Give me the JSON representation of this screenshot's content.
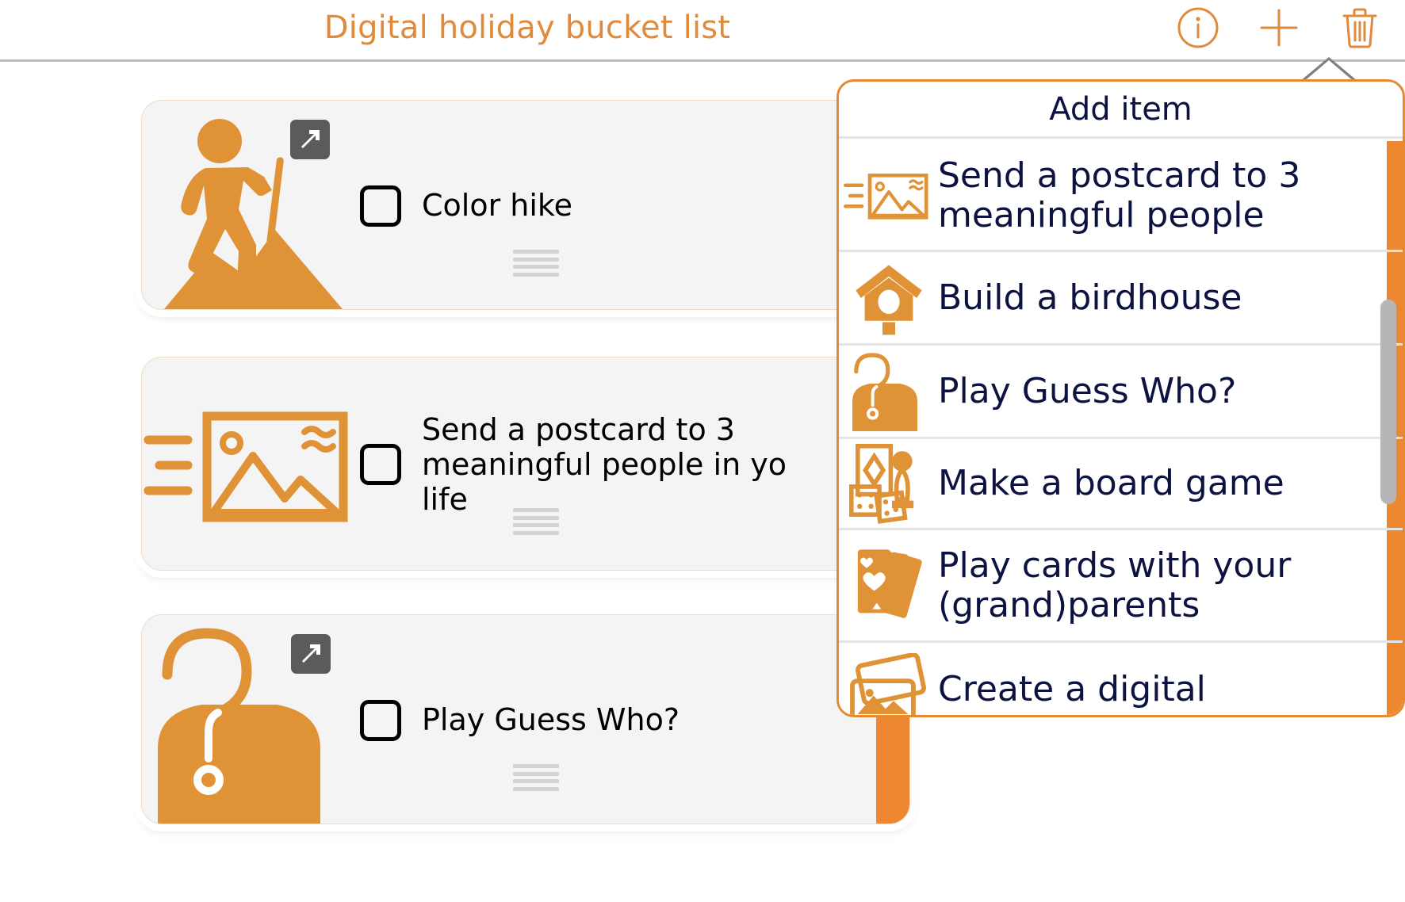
{
  "header": {
    "title": "Digital holiday bucket list",
    "accent_color": "#e08a3c",
    "actions": [
      {
        "name": "info-icon",
        "label": "Info"
      },
      {
        "name": "plus-icon",
        "label": "Add"
      },
      {
        "name": "trash-icon",
        "label": "Delete"
      }
    ]
  },
  "list": {
    "items": [
      {
        "label": "Color hike",
        "icon": "hiker-icon",
        "checked": false,
        "has_expand_badge": true,
        "has_swipe_bar": false
      },
      {
        "label": "Send a postcard to 3 meaningful people in yo life",
        "icon": "postcard-icon",
        "checked": false,
        "has_expand_badge": false,
        "has_swipe_bar": false
      },
      {
        "label": "Play Guess Who?",
        "icon": "person-question-icon",
        "checked": false,
        "has_expand_badge": true,
        "has_swipe_bar": true
      }
    ]
  },
  "dropdown": {
    "title": "Add item",
    "border_color": "#e58a30",
    "text_color": "#0d1340",
    "bar_color": "#ee8732",
    "items": [
      {
        "label": "Send a postcard to 3 meaningful people",
        "icon": "postcard-icon"
      },
      {
        "label": "Build a birdhouse",
        "icon": "birdhouse-icon"
      },
      {
        "label": "Play Guess Who?",
        "icon": "person-question-icon"
      },
      {
        "label": "Make a board game",
        "icon": "board-game-icon"
      },
      {
        "label": "Play cards with your (grand)parents",
        "icon": "playing-cards-icon"
      },
      {
        "label": "Create a digital",
        "icon": "photos-stack-icon"
      }
    ],
    "scrollbar": {
      "visible": true
    }
  }
}
